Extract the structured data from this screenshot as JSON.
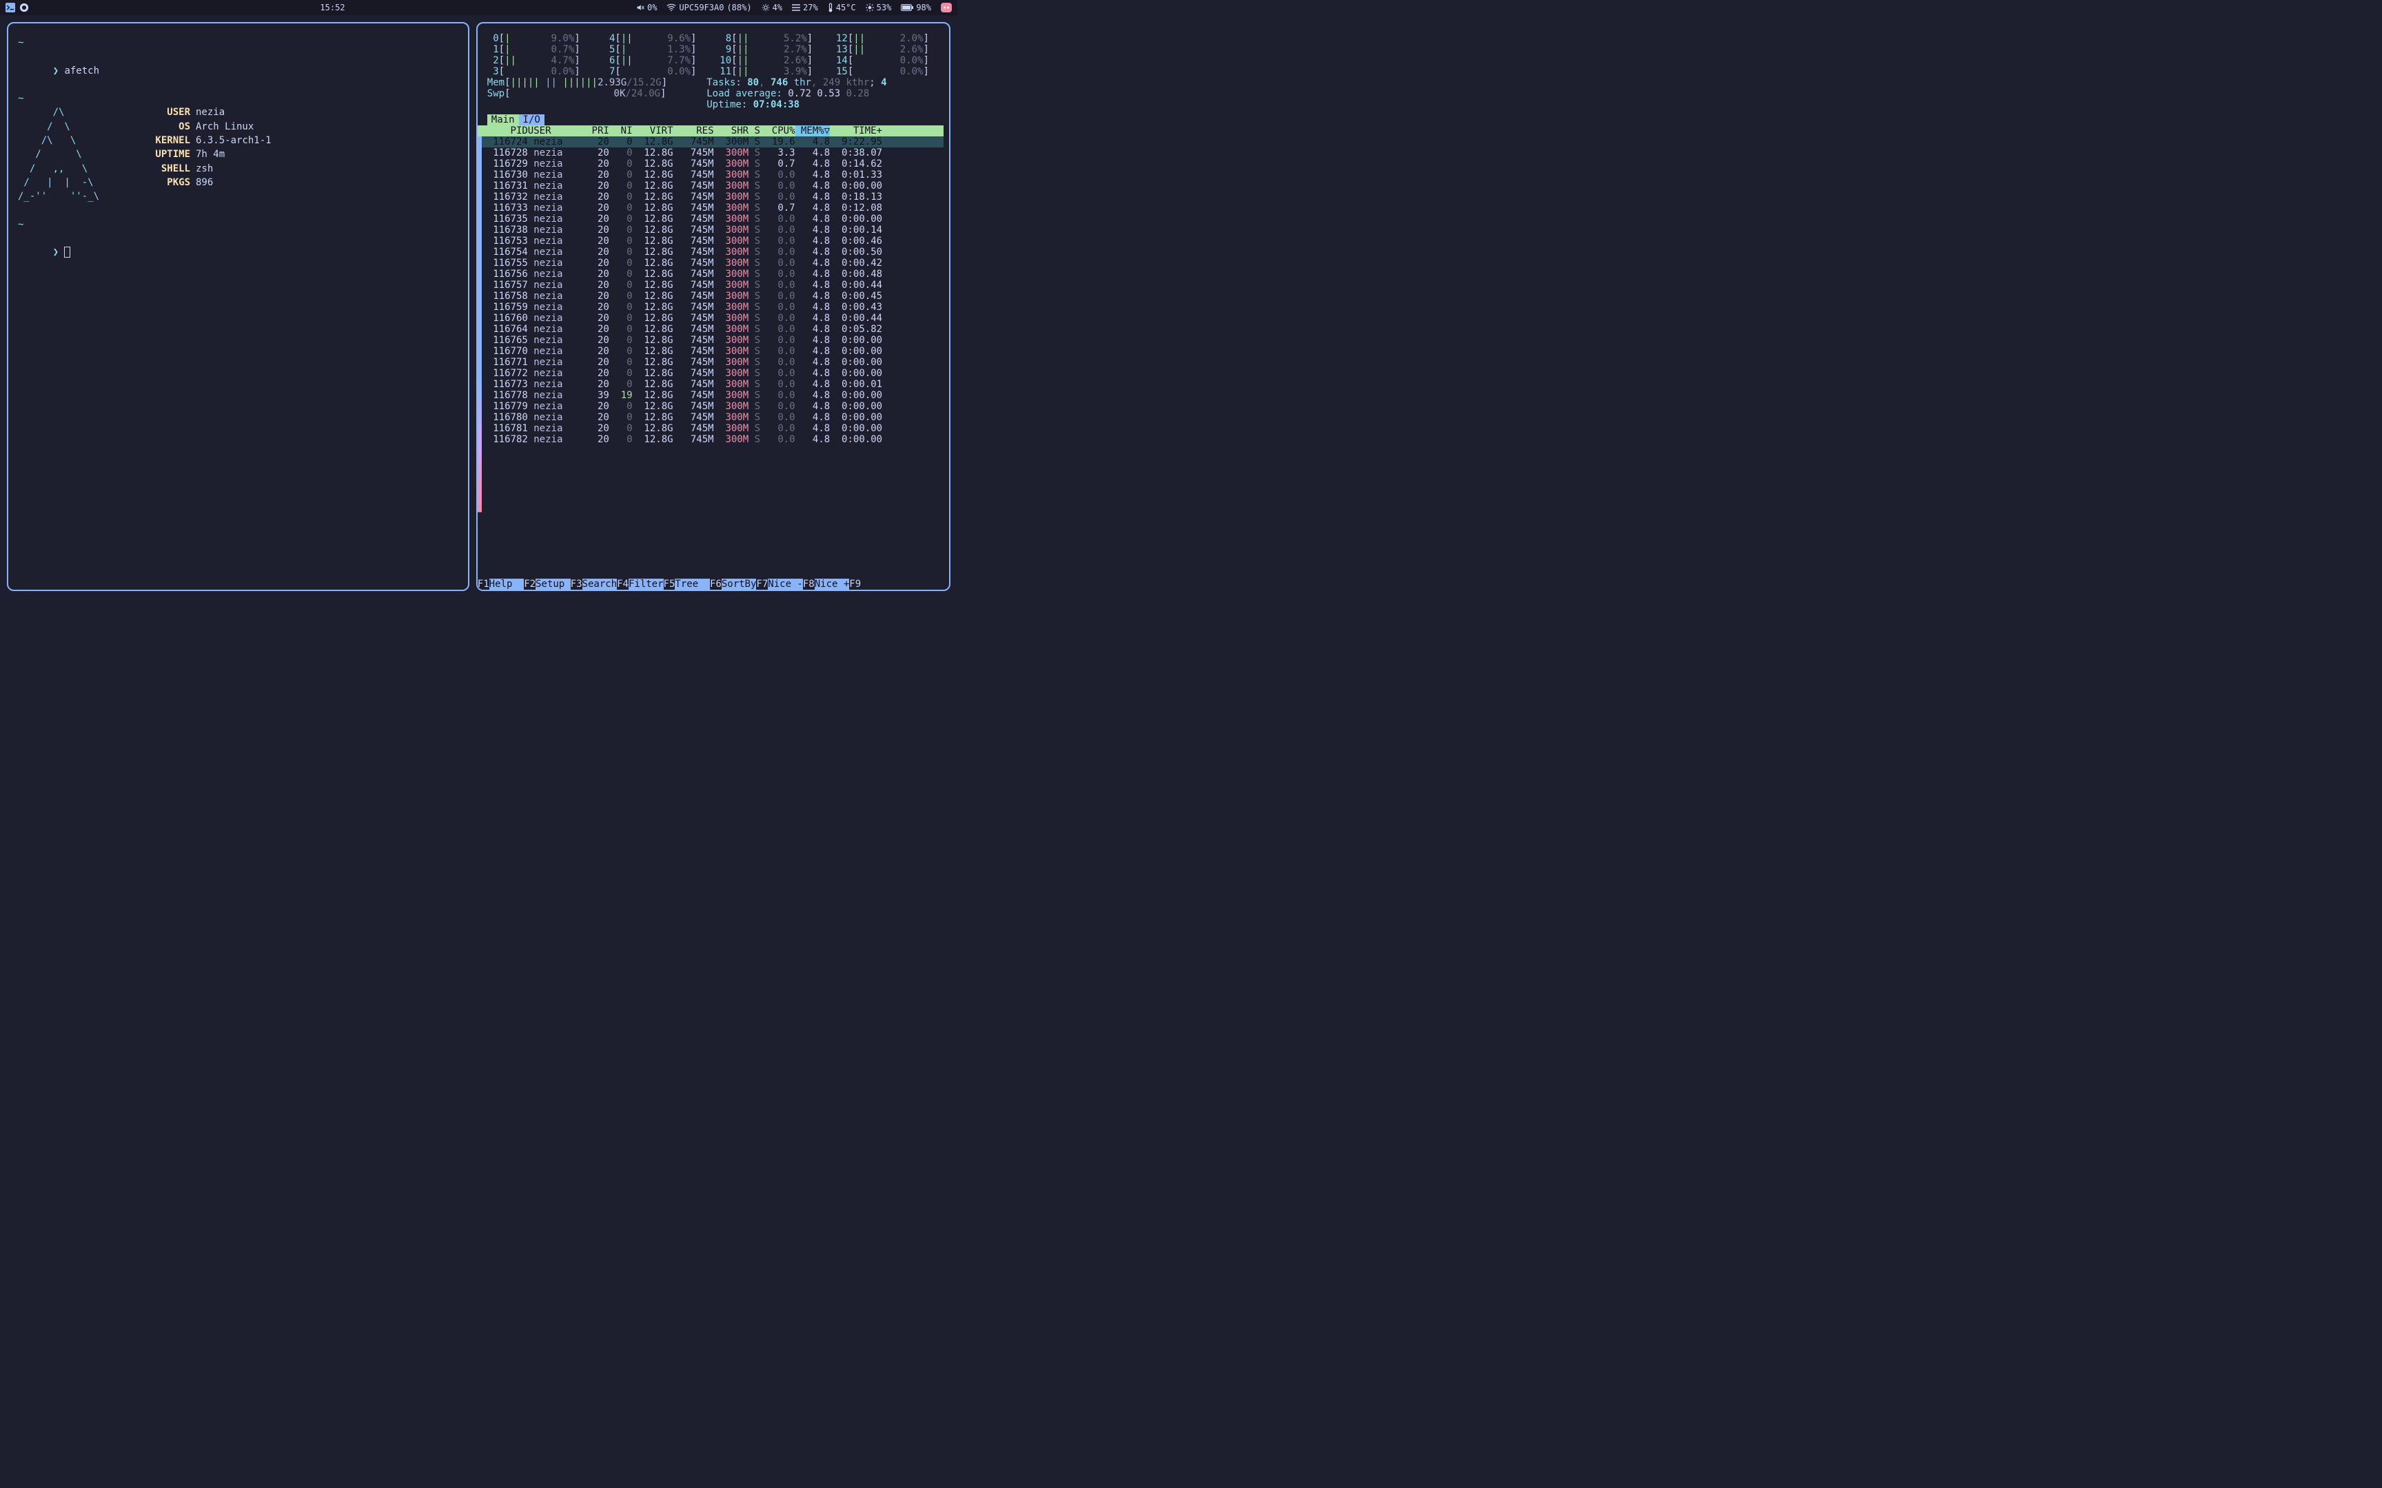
{
  "topbar": {
    "clock": "15:52",
    "volume_pct": "0%",
    "wifi_ssid": "UPC59F3A0",
    "wifi_signal": "(88%)",
    "gear_pct": "4%",
    "bars_pct": "27%",
    "temp": "45°C",
    "sun_pct": "53%",
    "battery_pct": "98%"
  },
  "afetch": {
    "command": "afetch",
    "ascii": [
      "~",
      "",
      "      /\\",
      "     /  \\",
      "    /\\   \\",
      "   /      \\",
      "  /   ,,   \\",
      " /   |  |  -\\",
      "/_-''    ''-_\\"
    ],
    "info": {
      "USER": "nezia",
      "OS": "Arch Linux",
      "KERNEL": "6.3.5-arch1-1",
      "UPTIME": "7h 4m",
      "SHELL": "zsh",
      "PKGS": "896"
    }
  },
  "htop": {
    "cpus": [
      [
        {
          "id": "0",
          "bar": "|",
          "pct": "9.0%"
        },
        {
          "id": "4",
          "bar": "||",
          "pct": "9.6%"
        },
        {
          "id": "8",
          "bar": "||",
          "pct": "5.2%"
        },
        {
          "id": "12",
          "bar": "||",
          "pct": "2.0%"
        }
      ],
      [
        {
          "id": "1",
          "bar": "|",
          "pct": "0.7%"
        },
        {
          "id": "5",
          "bar": "|",
          "pct": "1.3%"
        },
        {
          "id": "9",
          "bar": "||",
          "pct": "2.7%"
        },
        {
          "id": "13",
          "bar": "||",
          "pct": "2.6%"
        }
      ],
      [
        {
          "id": "2",
          "bar": "||",
          "pct": "4.7%"
        },
        {
          "id": "6",
          "bar": "||",
          "pct": "7.7%"
        },
        {
          "id": "10",
          "bar": "||",
          "pct": "2.6%"
        },
        {
          "id": "14",
          "bar": "",
          "pct": "0.0%"
        }
      ],
      [
        {
          "id": "3",
          "bar": "",
          "pct": "0.0%"
        },
        {
          "id": "7",
          "bar": "",
          "pct": "0.0%"
        },
        {
          "id": "11",
          "bar": "||",
          "pct": "3.9%"
        },
        {
          "id": "15",
          "bar": "",
          "pct": "0.0%"
        }
      ]
    ],
    "mem": {
      "label": "Mem",
      "used": "2.93G",
      "total": "15.2G"
    },
    "swp": {
      "label": "Swp",
      "used": "0K",
      "total": "24.0G"
    },
    "tasks": {
      "label": "Tasks:",
      "n": "80",
      "thr": "746",
      "kthr": "249",
      "running": "4"
    },
    "load": {
      "label": "Load average:",
      "v1": "0.72",
      "v2": "0.53",
      "v3": "0.28"
    },
    "uptime": {
      "label": "Uptime:",
      "value": "07:04:38"
    },
    "tabs": {
      "main": "Main",
      "io": "I/O"
    },
    "columns": [
      "PID",
      "USER",
      "PRI",
      "NI",
      "VIRT",
      "RES",
      "SHR",
      "S",
      "CPU%",
      "MEM%▽",
      "TIME+"
    ],
    "processes": [
      {
        "pid": "116724",
        "user": "nezia",
        "pri": "20",
        "ni": "0",
        "virt": "12.8G",
        "res": "745M",
        "shr": "300M",
        "s": "S",
        "cpu": "19.6",
        "mem": "4.8",
        "time": "9:22.95",
        "sel": true
      },
      {
        "pid": "116728",
        "user": "nezia",
        "pri": "20",
        "ni": "0",
        "virt": "12.8G",
        "res": "745M",
        "shr": "300M",
        "s": "S",
        "cpu": "3.3",
        "mem": "4.8",
        "time": "0:38.07"
      },
      {
        "pid": "116729",
        "user": "nezia",
        "pri": "20",
        "ni": "0",
        "virt": "12.8G",
        "res": "745M",
        "shr": "300M",
        "s": "S",
        "cpu": "0.7",
        "mem": "4.8",
        "time": "0:14.62"
      },
      {
        "pid": "116730",
        "user": "nezia",
        "pri": "20",
        "ni": "0",
        "virt": "12.8G",
        "res": "745M",
        "shr": "300M",
        "s": "S",
        "cpu": "0.0",
        "mem": "4.8",
        "time": "0:01.33"
      },
      {
        "pid": "116731",
        "user": "nezia",
        "pri": "20",
        "ni": "0",
        "virt": "12.8G",
        "res": "745M",
        "shr": "300M",
        "s": "S",
        "cpu": "0.0",
        "mem": "4.8",
        "time": "0:00.00"
      },
      {
        "pid": "116732",
        "user": "nezia",
        "pri": "20",
        "ni": "0",
        "virt": "12.8G",
        "res": "745M",
        "shr": "300M",
        "s": "S",
        "cpu": "0.0",
        "mem": "4.8",
        "time": "0:18.13"
      },
      {
        "pid": "116733",
        "user": "nezia",
        "pri": "20",
        "ni": "0",
        "virt": "12.8G",
        "res": "745M",
        "shr": "300M",
        "s": "S",
        "cpu": "0.7",
        "mem": "4.8",
        "time": "0:12.08"
      },
      {
        "pid": "116735",
        "user": "nezia",
        "pri": "20",
        "ni": "0",
        "virt": "12.8G",
        "res": "745M",
        "shr": "300M",
        "s": "S",
        "cpu": "0.0",
        "mem": "4.8",
        "time": "0:00.00"
      },
      {
        "pid": "116738",
        "user": "nezia",
        "pri": "20",
        "ni": "0",
        "virt": "12.8G",
        "res": "745M",
        "shr": "300M",
        "s": "S",
        "cpu": "0.0",
        "mem": "4.8",
        "time": "0:00.14"
      },
      {
        "pid": "116753",
        "user": "nezia",
        "pri": "20",
        "ni": "0",
        "virt": "12.8G",
        "res": "745M",
        "shr": "300M",
        "s": "S",
        "cpu": "0.0",
        "mem": "4.8",
        "time": "0:00.46"
      },
      {
        "pid": "116754",
        "user": "nezia",
        "pri": "20",
        "ni": "0",
        "virt": "12.8G",
        "res": "745M",
        "shr": "300M",
        "s": "S",
        "cpu": "0.0",
        "mem": "4.8",
        "time": "0:00.50"
      },
      {
        "pid": "116755",
        "user": "nezia",
        "pri": "20",
        "ni": "0",
        "virt": "12.8G",
        "res": "745M",
        "shr": "300M",
        "s": "S",
        "cpu": "0.0",
        "mem": "4.8",
        "time": "0:00.42"
      },
      {
        "pid": "116756",
        "user": "nezia",
        "pri": "20",
        "ni": "0",
        "virt": "12.8G",
        "res": "745M",
        "shr": "300M",
        "s": "S",
        "cpu": "0.0",
        "mem": "4.8",
        "time": "0:00.48"
      },
      {
        "pid": "116757",
        "user": "nezia",
        "pri": "20",
        "ni": "0",
        "virt": "12.8G",
        "res": "745M",
        "shr": "300M",
        "s": "S",
        "cpu": "0.0",
        "mem": "4.8",
        "time": "0:00.44"
      },
      {
        "pid": "116758",
        "user": "nezia",
        "pri": "20",
        "ni": "0",
        "virt": "12.8G",
        "res": "745M",
        "shr": "300M",
        "s": "S",
        "cpu": "0.0",
        "mem": "4.8",
        "time": "0:00.45"
      },
      {
        "pid": "116759",
        "user": "nezia",
        "pri": "20",
        "ni": "0",
        "virt": "12.8G",
        "res": "745M",
        "shr": "300M",
        "s": "S",
        "cpu": "0.0",
        "mem": "4.8",
        "time": "0:00.43"
      },
      {
        "pid": "116760",
        "user": "nezia",
        "pri": "20",
        "ni": "0",
        "virt": "12.8G",
        "res": "745M",
        "shr": "300M",
        "s": "S",
        "cpu": "0.0",
        "mem": "4.8",
        "time": "0:00.44"
      },
      {
        "pid": "116764",
        "user": "nezia",
        "pri": "20",
        "ni": "0",
        "virt": "12.8G",
        "res": "745M",
        "shr": "300M",
        "s": "S",
        "cpu": "0.0",
        "mem": "4.8",
        "time": "0:05.82"
      },
      {
        "pid": "116765",
        "user": "nezia",
        "pri": "20",
        "ni": "0",
        "virt": "12.8G",
        "res": "745M",
        "shr": "300M",
        "s": "S",
        "cpu": "0.0",
        "mem": "4.8",
        "time": "0:00.00"
      },
      {
        "pid": "116770",
        "user": "nezia",
        "pri": "20",
        "ni": "0",
        "virt": "12.8G",
        "res": "745M",
        "shr": "300M",
        "s": "S",
        "cpu": "0.0",
        "mem": "4.8",
        "time": "0:00.00"
      },
      {
        "pid": "116771",
        "user": "nezia",
        "pri": "20",
        "ni": "0",
        "virt": "12.8G",
        "res": "745M",
        "shr": "300M",
        "s": "S",
        "cpu": "0.0",
        "mem": "4.8",
        "time": "0:00.00"
      },
      {
        "pid": "116772",
        "user": "nezia",
        "pri": "20",
        "ni": "0",
        "virt": "12.8G",
        "res": "745M",
        "shr": "300M",
        "s": "S",
        "cpu": "0.0",
        "mem": "4.8",
        "time": "0:00.00"
      },
      {
        "pid": "116773",
        "user": "nezia",
        "pri": "20",
        "ni": "0",
        "virt": "12.8G",
        "res": "745M",
        "shr": "300M",
        "s": "S",
        "cpu": "0.0",
        "mem": "4.8",
        "time": "0:00.01"
      },
      {
        "pid": "116778",
        "user": "nezia",
        "pri": "39",
        "ni": "19",
        "virt": "12.8G",
        "res": "745M",
        "shr": "300M",
        "s": "S",
        "cpu": "0.0",
        "mem": "4.8",
        "time": "0:00.00"
      },
      {
        "pid": "116779",
        "user": "nezia",
        "pri": "20",
        "ni": "0",
        "virt": "12.8G",
        "res": "745M",
        "shr": "300M",
        "s": "S",
        "cpu": "0.0",
        "mem": "4.8",
        "time": "0:00.00"
      },
      {
        "pid": "116780",
        "user": "nezia",
        "pri": "20",
        "ni": "0",
        "virt": "12.8G",
        "res": "745M",
        "shr": "300M",
        "s": "S",
        "cpu": "0.0",
        "mem": "4.8",
        "time": "0:00.00"
      },
      {
        "pid": "116781",
        "user": "nezia",
        "pri": "20",
        "ni": "0",
        "virt": "12.8G",
        "res": "745M",
        "shr": "300M",
        "s": "S",
        "cpu": "0.0",
        "mem": "4.8",
        "time": "0:00.00"
      },
      {
        "pid": "116782",
        "user": "nezia",
        "pri": "20",
        "ni": "0",
        "virt": "12.8G",
        "res": "745M",
        "shr": "300M",
        "s": "S",
        "cpu": "0.0",
        "mem": "4.8",
        "time": "0:00.00"
      }
    ],
    "fnbar": [
      {
        "k": "F1",
        "l": "Help  "
      },
      {
        "k": "F2",
        "l": "Setup "
      },
      {
        "k": "F3",
        "l": "Search"
      },
      {
        "k": "F4",
        "l": "Filter"
      },
      {
        "k": "F5",
        "l": "Tree  "
      },
      {
        "k": "F6",
        "l": "SortBy"
      },
      {
        "k": "F7",
        "l": "Nice -"
      },
      {
        "k": "F8",
        "l": "Nice +"
      },
      {
        "k": "F9",
        "l": ""
      }
    ]
  }
}
